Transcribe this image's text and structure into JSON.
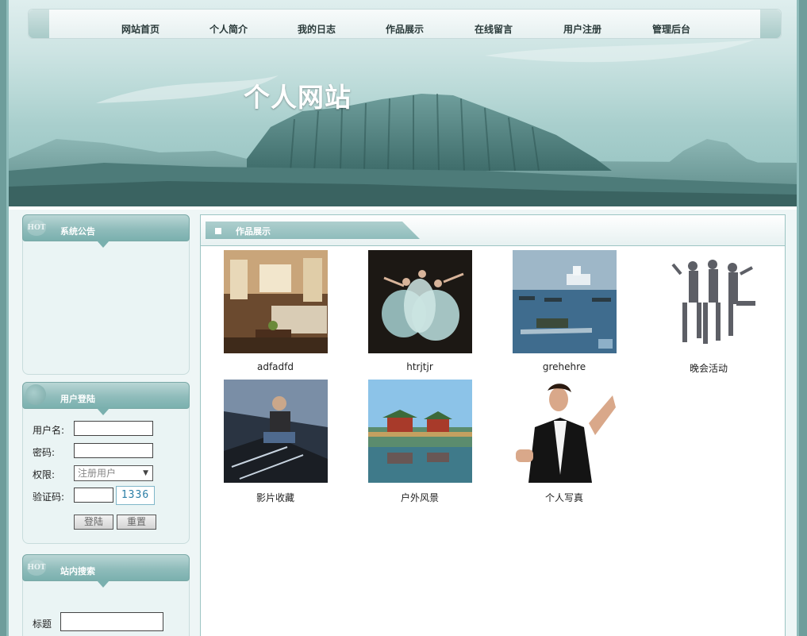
{
  "nav": {
    "items": [
      {
        "label": "网站首页"
      },
      {
        "label": "个人简介"
      },
      {
        "label": "我的日志"
      },
      {
        "label": "作品展示"
      },
      {
        "label": "在线留言"
      },
      {
        "label": "用户注册"
      },
      {
        "label": "管理后台"
      }
    ]
  },
  "header": {
    "site_title": "个人网站"
  },
  "sidebar": {
    "announcement": {
      "badge": "HOT",
      "title": "系统公告"
    },
    "login": {
      "title": "用户登陆",
      "username_label": "用户名:",
      "password_label": "密码:",
      "role_label": "权限:",
      "role_value": "注册用户",
      "captcha_label": "验证码:",
      "captcha_value": "1336",
      "login_button": "登陆",
      "reset_button": "重置"
    },
    "search": {
      "badge": "HOT",
      "title": "站内搜索",
      "title_label": "标题"
    }
  },
  "main": {
    "section_title": "作品展示",
    "works": [
      {
        "caption": "adfadfd",
        "image": "living-room-photo"
      },
      {
        "caption": "htrjtjr",
        "image": "ballet-dancers-photo"
      },
      {
        "caption": "grehehre",
        "image": "navy-ships-photo"
      },
      {
        "caption": "晚会活动",
        "image": "dance-troupe-photo"
      },
      {
        "caption": "影片收藏",
        "image": "movie-poster-photo"
      },
      {
        "caption": "户外风景",
        "image": "pavilion-lake-photo"
      },
      {
        "caption": "个人写真",
        "image": "portrait-photo"
      }
    ]
  },
  "colors": {
    "accent": "#8fbcbb",
    "page_bg": "#eef6f6",
    "frame": "#6e9d9b"
  }
}
